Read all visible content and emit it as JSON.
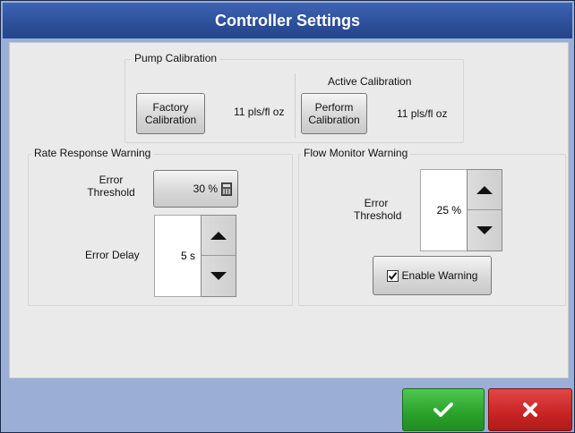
{
  "window": {
    "title": "Controller Settings"
  },
  "pump_calibration": {
    "group_label": "Pump Calibration",
    "factory_button_label": "Factory Calibration",
    "factory_value": "11 pls/fl oz",
    "active_label": "Active Calibration",
    "perform_button_label": "Perform Calibration",
    "active_value": "11 pls/fl oz"
  },
  "rate_response": {
    "group_label": "Rate Response Warning",
    "threshold_label": "Error Threshold",
    "threshold_value": "30 %",
    "delay_label": "Error Delay",
    "delay_value": "5 s"
  },
  "flow_monitor": {
    "group_label": "Flow Monitor Warning",
    "threshold_label": "Error Threshold",
    "threshold_value": "25 %",
    "enable_label": "Enable Warning",
    "enable_checked": true
  },
  "colors": {
    "title_bar": "#2b4f9a",
    "ok": "#2aa22a",
    "cancel": "#c82424",
    "frame": "#9aaed6"
  }
}
